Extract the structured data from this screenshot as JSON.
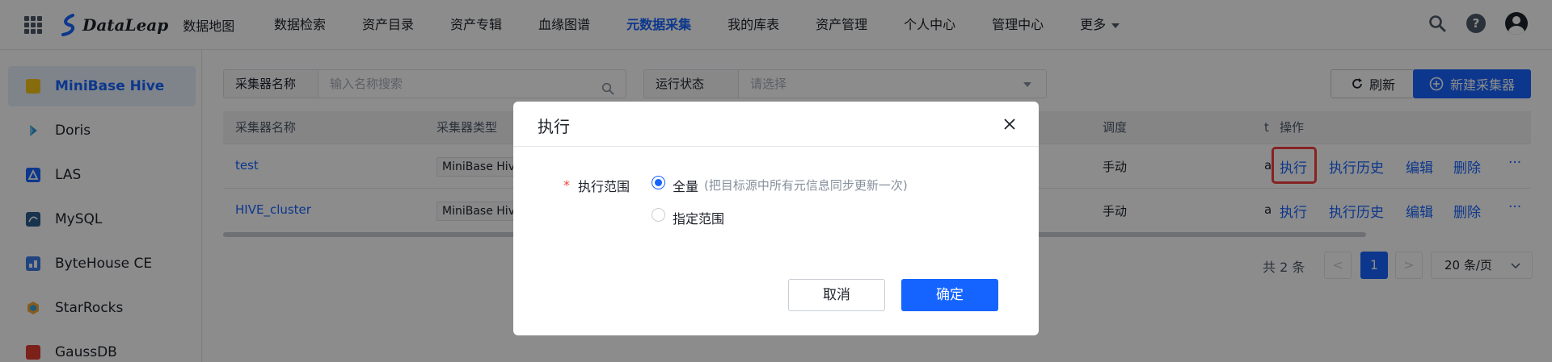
{
  "header": {
    "logo_text": "DataLeap",
    "logo_sub": "数据地图",
    "nav": [
      "数据检索",
      "资产目录",
      "资产专辑",
      "血缘图谱",
      "元数据采集",
      "我的库表",
      "资产管理",
      "个人中心",
      "管理中心",
      "更多"
    ],
    "active_nav": "元数据采集",
    "help_glyph": "?"
  },
  "sidebar": {
    "items": [
      {
        "label": "MiniBase Hive",
        "icon": "hive-icon",
        "color": "#f5c518"
      },
      {
        "label": "Doris",
        "icon": "doris-icon",
        "color": "#2f9bd6"
      },
      {
        "label": "LAS",
        "icon": "las-icon",
        "color": "#1664ff"
      },
      {
        "label": "MySQL",
        "icon": "mysql-icon",
        "color": "#2a5d8c"
      },
      {
        "label": "ByteHouse CE",
        "icon": "bytehouse-icon",
        "color": "#3b7ce8"
      },
      {
        "label": "StarRocks",
        "icon": "starrocks-icon",
        "color": "#f2a83b"
      },
      {
        "label": "GaussDB",
        "icon": "gaussdb-icon",
        "color": "#e03c31"
      }
    ],
    "active_index": 0
  },
  "filters": {
    "name_label": "采集器名称",
    "name_placeholder": "输入名称搜索",
    "status_label": "运行状态",
    "status_placeholder": "请选择"
  },
  "toolbar": {
    "refresh_label": "刷新",
    "new_label": "新建采集器"
  },
  "table": {
    "columns": [
      "采集器名称",
      "采集器类型",
      "调度",
      "操作"
    ],
    "rows": [
      {
        "name": "test",
        "type": "MiniBase Hive",
        "schedule": "手动",
        "cut": "a"
      },
      {
        "name": "HIVE_cluster",
        "type": "MiniBase Hive",
        "schedule": "手动",
        "cut": "a"
      }
    ],
    "actions": [
      "执行",
      "执行历史",
      "编辑",
      "删除",
      "···"
    ],
    "col_cut": "t"
  },
  "pagination": {
    "total": "共 2 条",
    "prev": "<",
    "current": "1",
    "next": ">",
    "page_size": "20 条/页"
  },
  "modal": {
    "title": "执行",
    "required_mark": "*",
    "field_label": "执行范围",
    "options": [
      {
        "label": "全量",
        "hint": "(把目标源中所有元信息同步更新一次)",
        "selected": true
      },
      {
        "label": "指定范围",
        "hint": "",
        "selected": false
      }
    ],
    "cancel_label": "取消",
    "ok_label": "确定"
  }
}
